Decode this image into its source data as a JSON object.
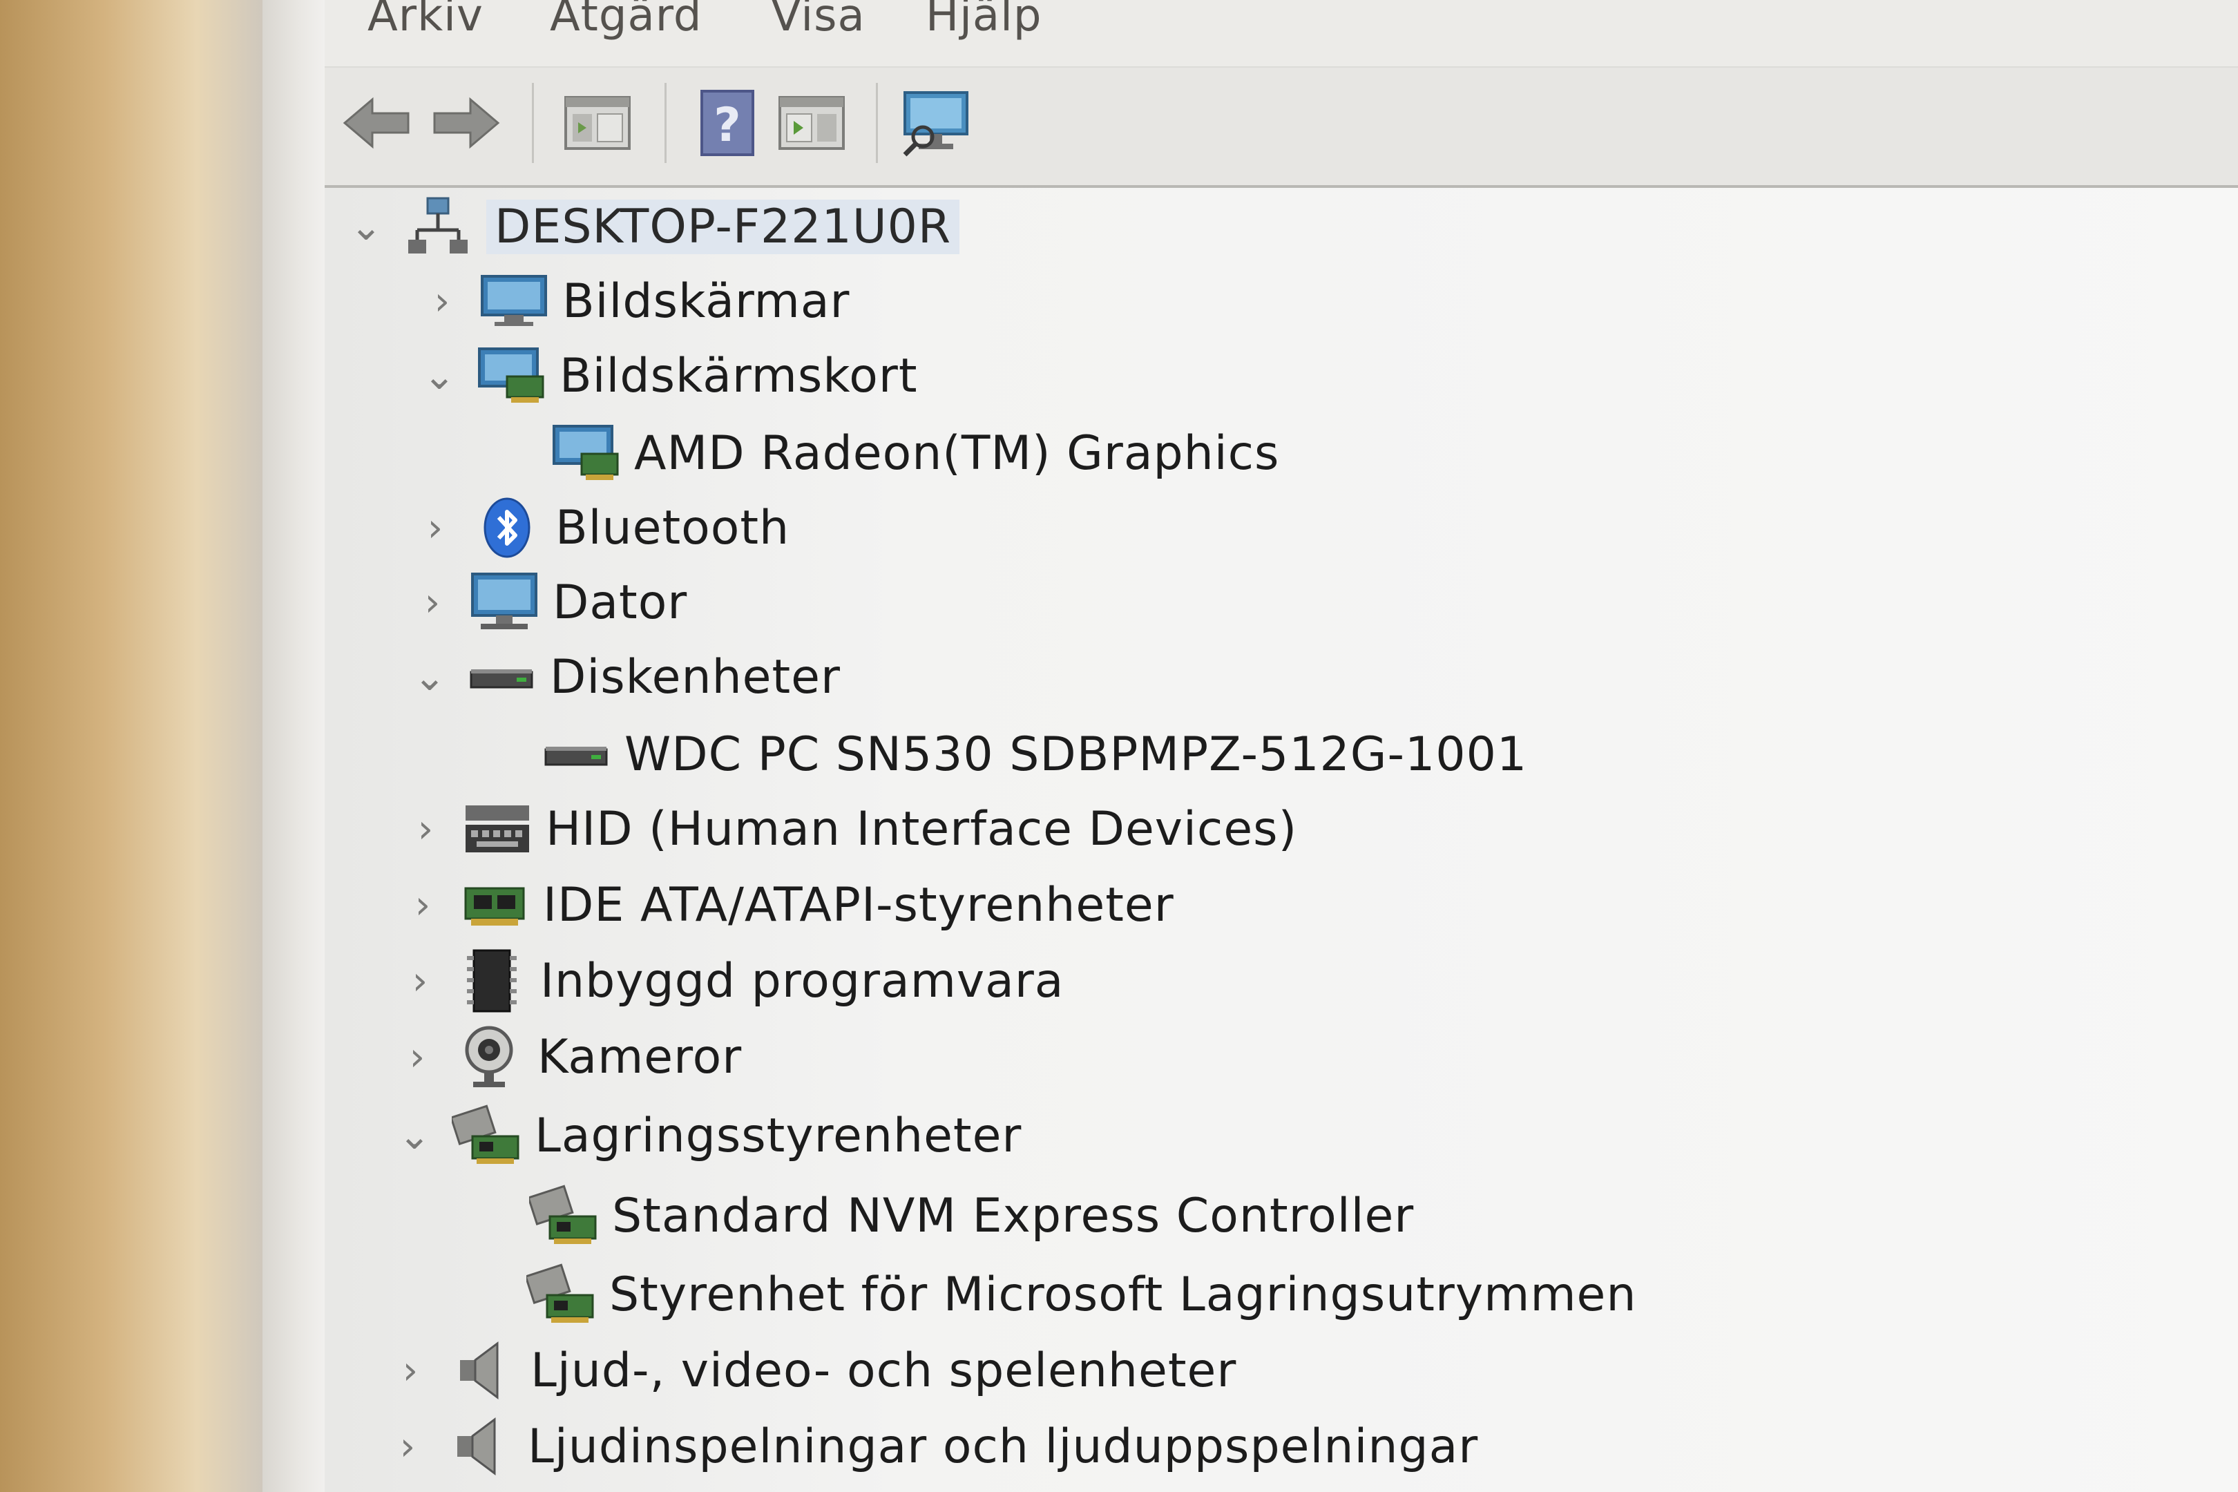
{
  "menu": {
    "items": [
      "Arkiv",
      "Åtgärd",
      "Visa",
      "Hjälp"
    ]
  },
  "toolbar": {
    "buttons": [
      {
        "name": "back-arrow-icon"
      },
      {
        "name": "forward-arrow-icon"
      },
      {
        "name": "console-tree-icon"
      },
      {
        "name": "help-icon",
        "glyph": "?"
      },
      {
        "name": "action-pane-icon"
      },
      {
        "name": "monitor-scan-icon"
      }
    ]
  },
  "tree": {
    "root": {
      "label": "DESKTOP-F221U0R",
      "expanded": true
    },
    "items": [
      {
        "label": "Bildskärmar",
        "expanded": false,
        "icon": "monitor-icon",
        "level": 1
      },
      {
        "label": "Bildskärmskort",
        "expanded": true,
        "icon": "display-adapter-icon",
        "level": 1
      },
      {
        "label": "AMD Radeon(TM) Graphics",
        "icon": "display-adapter-icon",
        "level": 2
      },
      {
        "label": "Bluetooth",
        "expanded": false,
        "icon": "bluetooth-icon",
        "level": 1
      },
      {
        "label": "Dator",
        "expanded": false,
        "icon": "computer-icon",
        "level": 1
      },
      {
        "label": "Diskenheter",
        "expanded": true,
        "icon": "disk-drive-icon",
        "level": 1
      },
      {
        "label": "WDC PC SN530 SDBPMPZ-512G-1001",
        "icon": "disk-drive-icon",
        "level": 2
      },
      {
        "label": "HID (Human Interface Devices)",
        "expanded": false,
        "icon": "hid-icon",
        "level": 1
      },
      {
        "label": "IDE ATA/ATAPI-styrenheter",
        "expanded": false,
        "icon": "ide-controller-icon",
        "level": 1
      },
      {
        "label": "Inbyggd programvara",
        "expanded": false,
        "icon": "firmware-chip-icon",
        "level": 1
      },
      {
        "label": "Kameror",
        "expanded": false,
        "icon": "camera-icon",
        "level": 1
      },
      {
        "label": "Lagringsstyrenheter",
        "expanded": true,
        "icon": "storage-controller-icon",
        "level": 1
      },
      {
        "label": "Standard NVM Express Controller",
        "icon": "storage-controller-icon",
        "level": 2
      },
      {
        "label": "Styrenhet för Microsoft Lagringsutrymmen",
        "icon": "storage-controller-icon",
        "level": 2
      },
      {
        "label": "Ljud-, video- och spelenheter",
        "expanded": false,
        "icon": "speaker-icon",
        "level": 1
      },
      {
        "label": "Ljudinspelningar och ljuduppspelningar",
        "expanded": false,
        "icon": "speaker-icon",
        "level": 1
      }
    ]
  },
  "colors": {
    "selection": "#dfe6ef",
    "text": "#1c1c1c",
    "chevron": "#7a7a78"
  }
}
